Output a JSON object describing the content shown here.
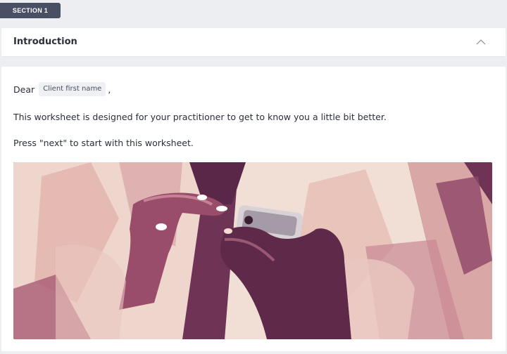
{
  "section": {
    "badge_label": "SECTION 1"
  },
  "header": {
    "title": "Introduction",
    "toggle_icon": "chevron-up-icon"
  },
  "content": {
    "greeting_word": "Dear",
    "placeholder_chip": "Client first name",
    "greeting_punct": ",",
    "paragraph_1": "This worksheet is designed for your practitioner to get to know you a little bit better.",
    "paragraph_2": "Press \"next\" to start with this worksheet."
  },
  "image": {
    "subject": "hands-holding-phone-illustration",
    "palette": [
      "#f3e3dc",
      "#e7b9b0",
      "#b9687d",
      "#7b3d5f",
      "#4a1f3e"
    ]
  },
  "colors": {
    "page_bg": "#eceef2",
    "badge_bg": "#4a5063",
    "card_bg": "#ffffff",
    "text": "#2b2f3a",
    "chip_bg": "#eef0f4"
  }
}
